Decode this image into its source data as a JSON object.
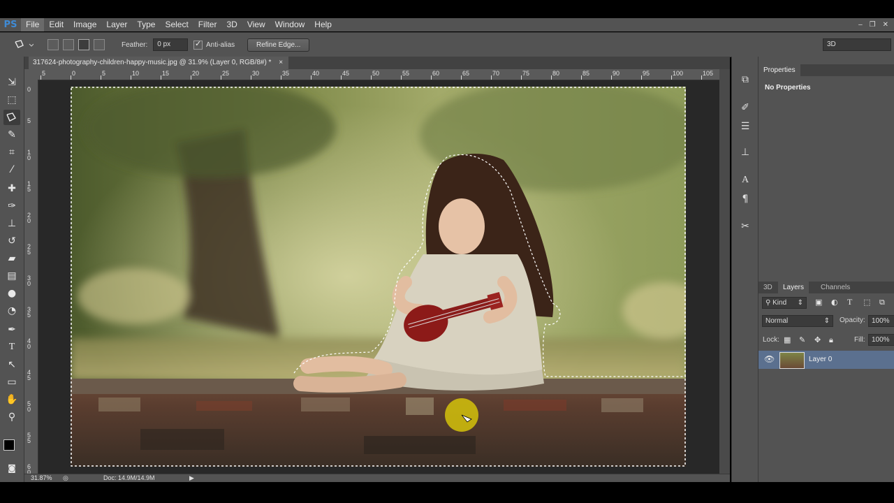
{
  "app": {
    "logo": "PS",
    "window_controls": [
      "–",
      "❐",
      "✕"
    ]
  },
  "menu": [
    "File",
    "Edit",
    "Image",
    "Layer",
    "Type",
    "Select",
    "Filter",
    "3D",
    "View",
    "Window",
    "Help"
  ],
  "options_bar": {
    "feather_label": "Feather:",
    "feather_value": "0 px",
    "antialias_label": "Anti-alias",
    "antialias_checked": true,
    "refine_edge_label": "Refine Edge...",
    "workspace_value": "3D"
  },
  "document": {
    "tab_title": "317624-photography-children-happy-music.jpg @ 31.9% (Layer 0, RGB/8#) *",
    "close_glyph": "×"
  },
  "ruler": {
    "horizontal": [
      "5",
      "0",
      "5",
      "10",
      "15",
      "20",
      "25",
      "30",
      "35",
      "40",
      "45",
      "50",
      "55",
      "60",
      "65",
      "70",
      "75",
      "80",
      "85",
      "90",
      "95",
      "100",
      "105"
    ],
    "vertical": [
      "0",
      "5",
      "1 0",
      "1 5",
      "2 0",
      "2 5",
      "3 0",
      "3 5",
      "4 0",
      "4 5",
      "5 0",
      "5 5",
      "6 0"
    ]
  },
  "status": {
    "zoom": "31.87%",
    "doc": "Doc: 14.9M/14.9M"
  },
  "properties": {
    "title": "Properties",
    "content": "No Properties"
  },
  "layers_panel": {
    "tabs": [
      "3D",
      "Layers",
      "Channels"
    ],
    "active_tab": "Layers",
    "filter_kind": "Kind",
    "blend_mode": "Normal",
    "opacity_label": "Opacity:",
    "opacity_value": "100%",
    "lock_label": "Lock:",
    "fill_label": "Fill:",
    "fill_value": "100%",
    "layers": [
      {
        "name": "Layer 0",
        "visible": true,
        "selected": true
      }
    ]
  },
  "colors": {
    "accent_selected_layer": "#5b708f",
    "ps_logo": "#3f8bd6",
    "cursor_highlight": "#d4c20a"
  }
}
